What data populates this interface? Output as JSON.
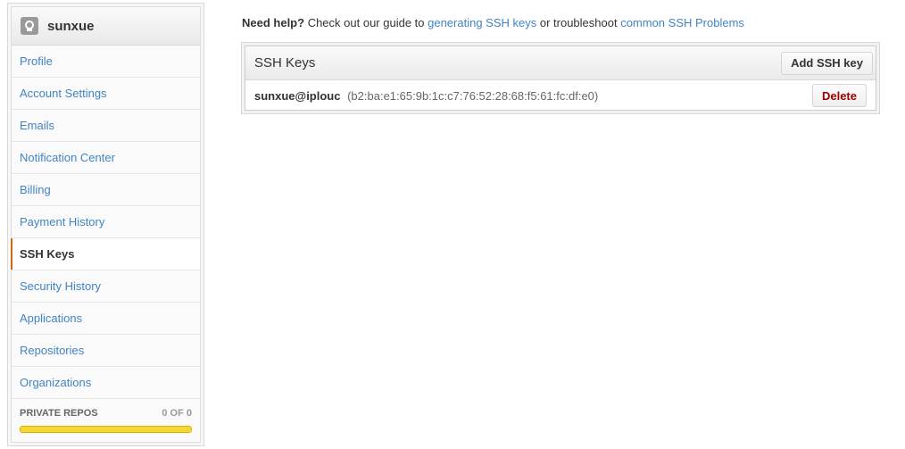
{
  "sidebar": {
    "username": "sunxue",
    "avatar_icon": "octocat-icon",
    "items": [
      {
        "label": "Profile",
        "selected": false
      },
      {
        "label": "Account Settings",
        "selected": false
      },
      {
        "label": "Emails",
        "selected": false
      },
      {
        "label": "Notification Center",
        "selected": false
      },
      {
        "label": "Billing",
        "selected": false
      },
      {
        "label": "Payment History",
        "selected": false
      },
      {
        "label": "SSH Keys",
        "selected": true
      },
      {
        "label": "Security History",
        "selected": false
      },
      {
        "label": "Applications",
        "selected": false
      },
      {
        "label": "Repositories",
        "selected": false
      },
      {
        "label": "Organizations",
        "selected": false
      }
    ],
    "private_repos_label": "PRIVATE REPOS",
    "private_repos_count": "0 OF 0",
    "private_repos_fill": 1.0,
    "accent_color": "#d26911",
    "progress_color": "#f4d730"
  },
  "help": {
    "lead": "Need help?",
    "text1": " Check out our guide to ",
    "link1": "generating SSH keys",
    "text2": " or troubleshoot ",
    "link2": "common SSH Problems"
  },
  "ssh_box": {
    "title": "SSH Keys",
    "add_button": "Add SSH key",
    "keys": [
      {
        "name": "sunxue@iplouc",
        "fingerprint": "(b2:ba:e1:65:9b:1c:c7:76:52:28:68:f5:61:fc:df:e0)",
        "delete_label": "Delete"
      }
    ]
  },
  "link_color": "#4183c4",
  "danger_color": "#990000"
}
